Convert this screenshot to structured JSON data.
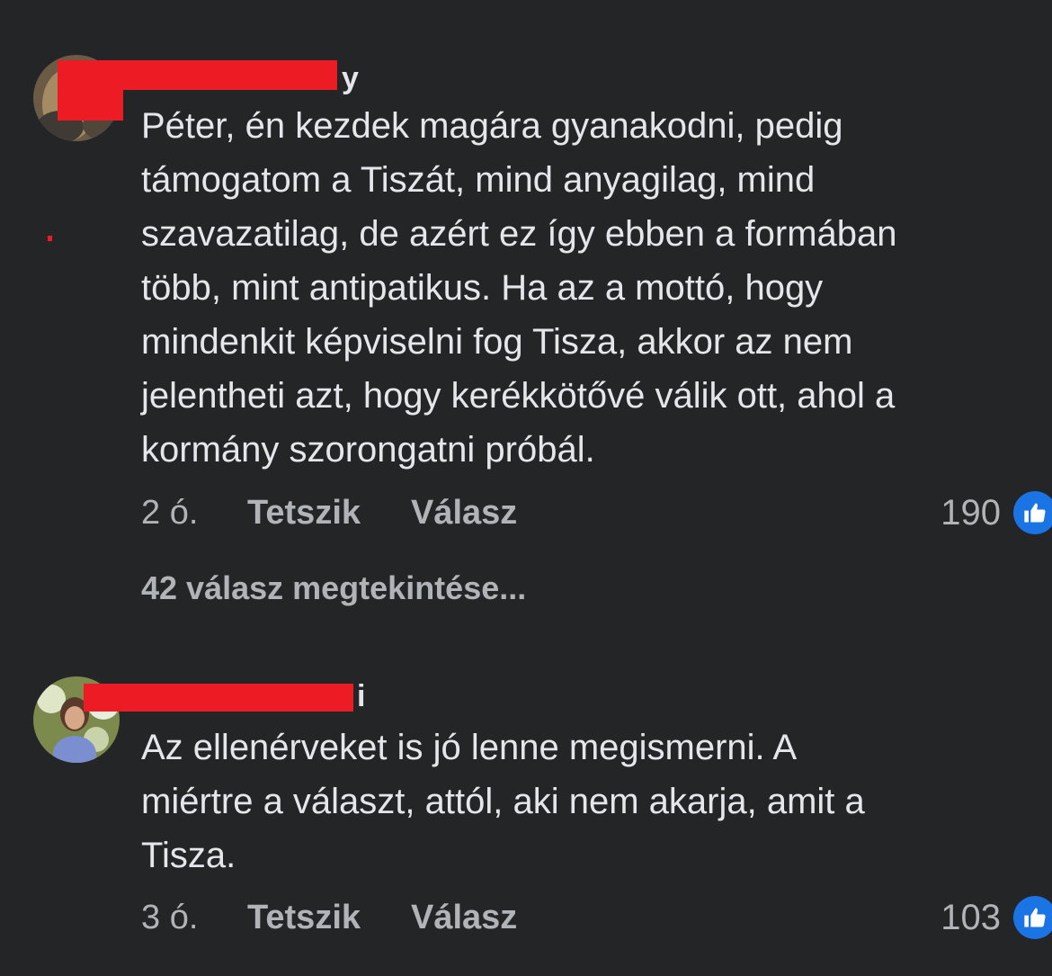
{
  "comments": [
    {
      "author_visible_suffix": "y",
      "text": "Péter, én kezdek magára gyanakodni, pedig\ntámogatom a Tiszát, mind anyagilag, mind\nszavazatilag, de azért ez így ebben a formában\ntöbb, mint antipatikus. Ha az a mottó, hogy\nmindenkit képviselni fog  Tisza, akkor az nem\njelentheti azt, hogy kerékkötővé válik ott, ahol a\nkormány szorongatni próbál.",
      "time": "2 ó.",
      "like_label": "Tetszik",
      "reply_label": "Válasz",
      "reaction_count": "190",
      "view_replies": "42 válasz megtekintése..."
    },
    {
      "author_visible_suffix": "i",
      "text": "Az ellenérveket is jó lenne megismerni. A\nmiértre a választ, attól, aki nem akarja, amit a\nTisza.",
      "time": "3 ó.",
      "like_label": "Tetszik",
      "reply_label": "Válasz",
      "reaction_count": "103"
    }
  ],
  "colors": {
    "background": "#242526",
    "primary_text": "#e4e6eb",
    "secondary_text": "#b0b3b8",
    "like_blue": "#1b74e4",
    "redaction_red": "#ed1c24"
  },
  "icons": {
    "reaction": "thumbs-up-icon"
  }
}
